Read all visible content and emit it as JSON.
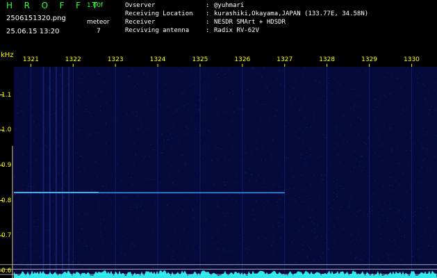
{
  "header": {
    "brand": "H R O F F T",
    "version": "1.00f",
    "filename": "2506151320.png",
    "datetime": "25.06.15 13:20",
    "mode": "meteor",
    "count": "7"
  },
  "info": [
    {
      "label": "Ovserver",
      "sep": ":",
      "value": "@yuhmari"
    },
    {
      "label": "Receiving Location",
      "sep": ":",
      "value": "kurashiki,Okayama,JAPAN (133.77E, 34.58N)"
    },
    {
      "label": "Receiver",
      "sep": ":",
      "value": "NESDR SMArt + HDSDR"
    },
    {
      "label": "Recviving antenna",
      "sep": ":",
      "value": "Radix RV-62V"
    }
  ],
  "chart_data": {
    "type": "heatmap",
    "ylabel": "kHz",
    "ylim": [
      0.58,
      1.18
    ],
    "yticks": [
      "1.1",
      "1.0",
      "0.9",
      "0.8",
      "0.7",
      "0.6"
    ],
    "yvalues": [
      1.1,
      1.0,
      0.9,
      0.8,
      0.7,
      0.6
    ],
    "xlim": [
      1320.6,
      1330.6
    ],
    "xticks": [
      "1321",
      "1322",
      "1323",
      "1324",
      "1325",
      "1326",
      "1327",
      "1328",
      "1329",
      "1330"
    ],
    "xvalues": [
      1321,
      1322,
      1323,
      1324,
      1325,
      1326,
      1327,
      1328,
      1329,
      1330
    ],
    "background": "#050a3a",
    "trace": {
      "start": 1320.6,
      "end": 1327.0,
      "freq": 0.822
    },
    "reference_lines": [
      0.618,
      0.605,
      0.59
    ],
    "colors": {
      "grid": "#1a2a88",
      "trace": "#3399ff",
      "ref": "#cccccc",
      "axis": "#ffff00",
      "floor": "#33ffff"
    }
  }
}
